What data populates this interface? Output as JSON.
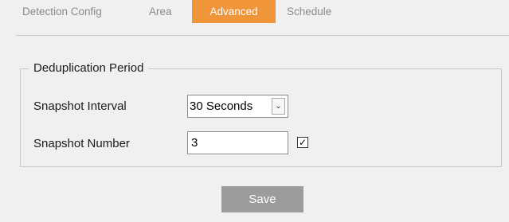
{
  "tabs": [
    {
      "label": "Detection Config",
      "active": false
    },
    {
      "label": "Area",
      "active": false
    },
    {
      "label": "Advanced",
      "active": true
    },
    {
      "label": "Schedule",
      "active": false
    }
  ],
  "dedup": {
    "legend": "Deduplication Period",
    "interval_label": "Snapshot Interval",
    "interval_value": "30 Seconds",
    "number_label": "Snapshot Number",
    "number_value": "3",
    "number_checked": true
  },
  "save_label": "Save",
  "colors": {
    "active_tab": "#f0953a",
    "save_button": "#9c9c9c",
    "background": "#f0f0f0"
  }
}
